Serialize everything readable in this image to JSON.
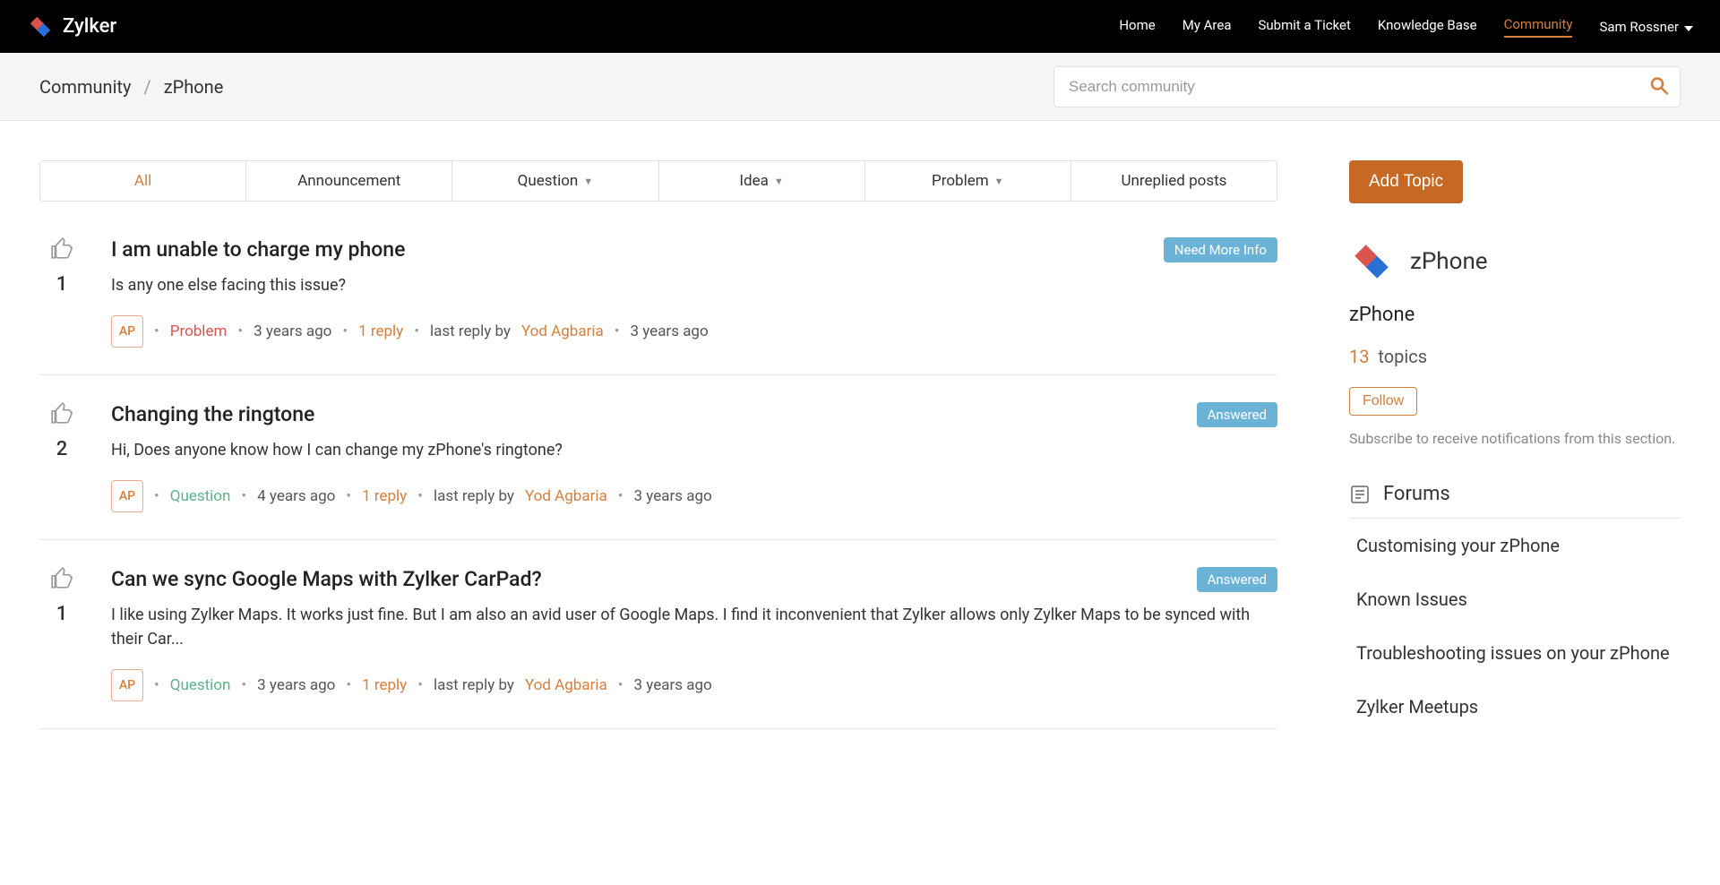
{
  "header": {
    "brand": "Zylker",
    "nav": [
      "Home",
      "My Area",
      "Submit a Ticket",
      "Knowledge Base",
      "Community"
    ],
    "active_nav": 4,
    "user": "Sam Rossner"
  },
  "breadcrumb": [
    "Community",
    "zPhone"
  ],
  "search": {
    "placeholder": "Search community"
  },
  "tabs": [
    {
      "label": "All",
      "chev": false
    },
    {
      "label": "Announcement",
      "chev": false
    },
    {
      "label": "Question",
      "chev": true
    },
    {
      "label": "Idea",
      "chev": true
    },
    {
      "label": "Problem",
      "chev": true
    },
    {
      "label": "Unreplied posts",
      "chev": false
    }
  ],
  "active_tab": 0,
  "topics": [
    {
      "votes": "1",
      "title": "I am unable to charge my phone",
      "badge": {
        "label": "Need More Info",
        "type": "info"
      },
      "excerpt": "Is any one else facing this issue?",
      "avatar": "AP",
      "type": {
        "label": "Problem",
        "cls": "type-problem"
      },
      "age": "3 years ago",
      "replies": "1 reply",
      "last_reply_by_prefix": "last reply by",
      "last_reply_author": "Yod Agbaria",
      "last_reply_age": "3 years ago"
    },
    {
      "votes": "2",
      "title": "Changing the ringtone",
      "badge": {
        "label": "Answered",
        "type": "answered"
      },
      "excerpt": "Hi, Does anyone know how I can change my zPhone's ringtone?",
      "avatar": "AP",
      "type": {
        "label": "Question",
        "cls": "type-question"
      },
      "age": "4 years ago",
      "replies": "1 reply",
      "last_reply_by_prefix": "last reply by",
      "last_reply_author": "Yod Agbaria",
      "last_reply_age": "3 years ago"
    },
    {
      "votes": "1",
      "title": "Can we sync Google Maps with Zylker CarPad?",
      "badge": {
        "label": "Answered",
        "type": "answered"
      },
      "excerpt": "I like using Zylker Maps. It works just fine. But I am also an avid user of Google Maps. I find it inconvenient that Zylker allows only Zylker Maps to be synced with their Car...",
      "avatar": "AP",
      "type": {
        "label": "Question",
        "cls": "type-question"
      },
      "age": "3 years ago",
      "replies": "1 reply",
      "last_reply_by_prefix": "last reply by",
      "last_reply_author": "Yod Agbaria",
      "last_reply_age": "3 years ago"
    }
  ],
  "sidebar": {
    "add_topic": "Add Topic",
    "product": "zPhone",
    "product_name": "zPhone",
    "topics_count": "13",
    "topics_label": "topics",
    "follow": "Follow",
    "subscribe_desc": "Subscribe to receive notifications from this section.",
    "forums_title": "Forums",
    "forums": [
      "Customising your zPhone",
      "Known Issues",
      "Troubleshooting issues on your zPhone",
      "Zylker Meetups"
    ]
  }
}
